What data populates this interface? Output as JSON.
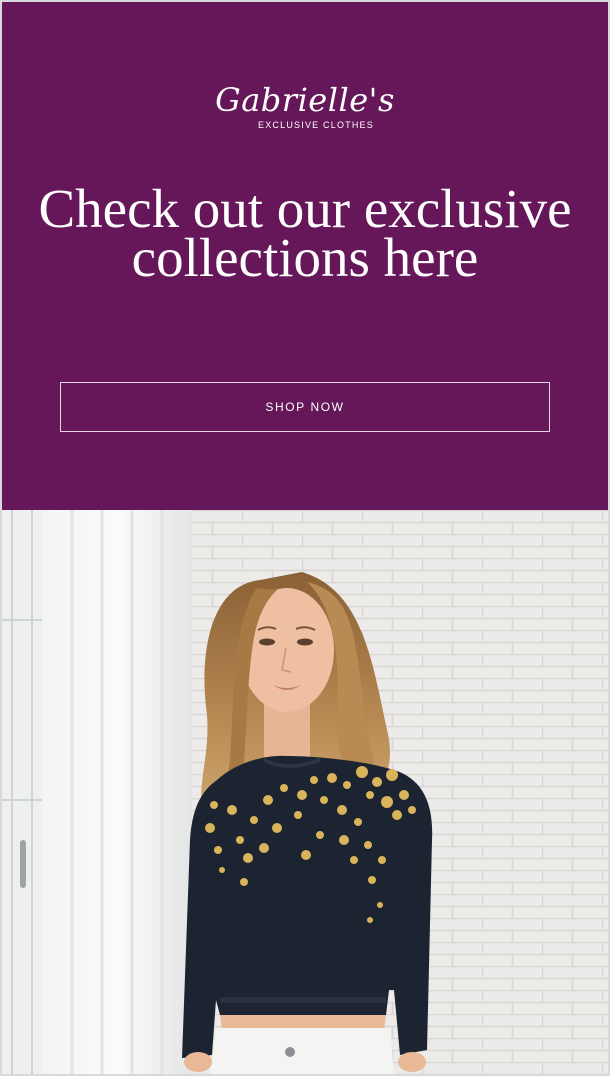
{
  "brand": {
    "name": "Gabrielle's",
    "tagline": "EXCLUSIVE CLOTHES"
  },
  "hero": {
    "headline": "Check out our exclusive collections here",
    "cta_label": "SHOP NOW"
  },
  "colors": {
    "hero_background": "#661759",
    "text": "#ffffff",
    "sweater": "#1c2331",
    "sequins": "#d9b45a"
  }
}
